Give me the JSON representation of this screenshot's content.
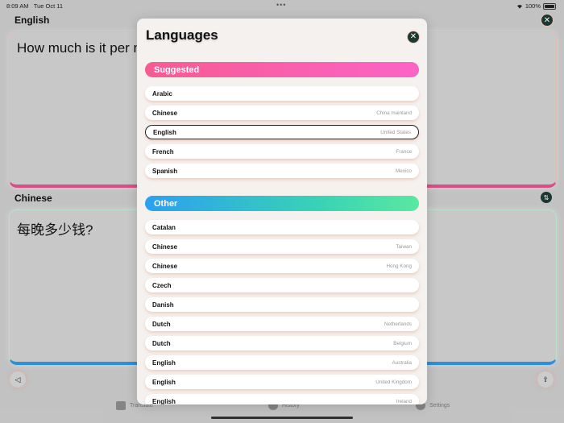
{
  "status": {
    "time": "8:09 AM",
    "date": "Tue Oct 11",
    "battery": "100%"
  },
  "background": {
    "source_language": "English",
    "source_text": "How much is it per n",
    "target_language": "Chinese",
    "target_text": "每晚多少钱?"
  },
  "tabbar": {
    "tabs": [
      {
        "label": "Translate",
        "icon": "speech-bubble-icon"
      },
      {
        "label": "History",
        "icon": "history-icon"
      },
      {
        "label": "Settings",
        "icon": "gear-icon"
      }
    ]
  },
  "modal": {
    "title": "Languages",
    "suggested_header": "Suggested",
    "other_header": "Other",
    "suggested": [
      {
        "name": "Arabic",
        "region": ""
      },
      {
        "name": "Chinese",
        "region": "China mainland"
      },
      {
        "name": "English",
        "region": "United States",
        "selected": true
      },
      {
        "name": "French",
        "region": "France"
      },
      {
        "name": "Spanish",
        "region": "Mexico"
      }
    ],
    "other": [
      {
        "name": "Catalan",
        "region": ""
      },
      {
        "name": "Chinese",
        "region": "Taiwan"
      },
      {
        "name": "Chinese",
        "region": "Hong Kong"
      },
      {
        "name": "Czech",
        "region": ""
      },
      {
        "name": "Danish",
        "region": ""
      },
      {
        "name": "Dutch",
        "region": "Netherlands"
      },
      {
        "name": "Dutch",
        "region": "Belgium"
      },
      {
        "name": "English",
        "region": "Australia"
      },
      {
        "name": "English",
        "region": "United Kingdom"
      },
      {
        "name": "English",
        "region": "Ireland"
      }
    ]
  },
  "colors": {
    "suggested_gradient": [
      "#f75b93",
      "#fb64c6"
    ],
    "other_gradient": [
      "#2ba0f0",
      "#5ae8a0"
    ],
    "accent_dark": "#1b3a31"
  }
}
